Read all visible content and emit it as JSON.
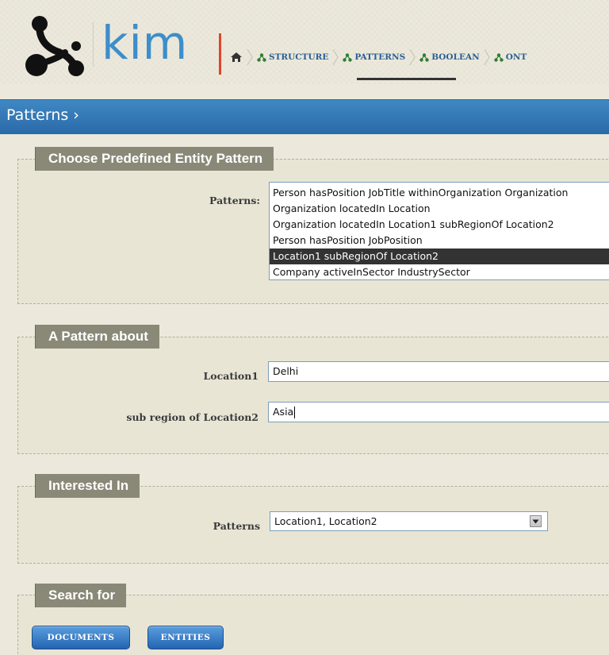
{
  "brand": {
    "name": "kim",
    "colors": {
      "logo_blue": "#3d8ec9",
      "accent_red": "#e0442a",
      "nav_link": "#2a5f96",
      "title_bar": "#2f74b2",
      "button": "#2f70bd"
    }
  },
  "nav": {
    "items": [
      {
        "label": "STRUCTURE",
        "icon": "tree-icon"
      },
      {
        "label": "PATTERNS",
        "icon": "tree-icon",
        "active": true
      },
      {
        "label": "BOOLEAN",
        "icon": "tree-icon"
      },
      {
        "label": "ONT",
        "icon": "tree-icon"
      }
    ]
  },
  "page": {
    "title": "Patterns ›"
  },
  "predefined": {
    "legend": "Choose Predefined Entity Pattern",
    "label": "Patterns:",
    "options": [
      "Person hasPosition JobTitle withinOrganization Organization",
      "Organization locatedIn Location",
      "Organization locatedIn Location1 subRegionOf Location2",
      "Person hasPosition JobPosition",
      "Location1 subRegionOf Location2",
      "Company activeInSector IndustrySector"
    ],
    "selected": "Location1 subRegionOf Location2"
  },
  "about": {
    "legend": "A Pattern about",
    "location1_label": "Location1",
    "location1_value": "Delhi",
    "location2_label": "sub region of Location2",
    "location2_value": "Asia"
  },
  "interested": {
    "legend": "Interested In",
    "label": "Patterns",
    "selected": "Location1, Location2"
  },
  "search": {
    "legend": "Search for",
    "documents_label": "DOCUMENTS",
    "entities_label": "ENTITIES"
  }
}
